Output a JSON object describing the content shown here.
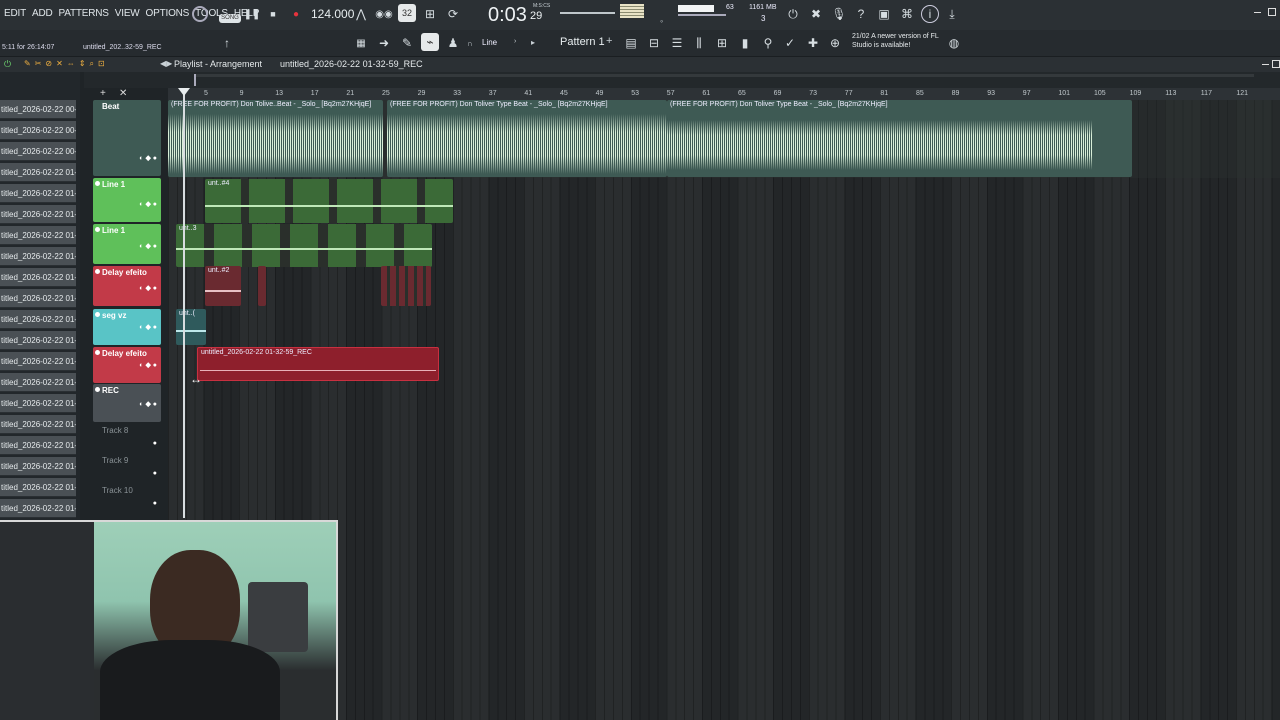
{
  "menu": [
    "EDIT",
    "ADD",
    "PATTERNS",
    "VIEW",
    "OPTIONS",
    "TOOLS",
    "HELP"
  ],
  "transport": {
    "mode": "SONG",
    "tempo": "124.000",
    "time": "0:03",
    "time_small": "29",
    "time_unit": "M:S:CS",
    "cpu": "63",
    "mem": "1161 MB",
    "voices": "3"
  },
  "hint": {
    "date": "21/02",
    "text": "A newer version of FL Studio is available!"
  },
  "toolbar2": {
    "line_label": "Line",
    "pattern": "Pattern 1"
  },
  "status": {
    "left": "5:11 for 26:14:07",
    "file": "untitled_202..32-59_REC"
  },
  "playlist": {
    "title": "Playlist - Arrangement",
    "file": "untitled_2026-02-22 01-32-59_REC"
  },
  "browser_items": [
    "titled_2026-02-22 00-...",
    "titled_2026-02-22 00-...",
    "titled_2026-02-22 00-...",
    "titled_2026-02-22 01-...",
    "titled_2026-02-22 01-...",
    "titled_2026-02-22 01-...",
    "titled_2026-02-22 01-...",
    "titled_2026-02-22 01-...",
    "titled_2026-02-22 01-...",
    "titled_2026-02-22 01-...",
    "titled_2026-02-22 01-...",
    "titled_2026-02-22 01-...",
    "titled_2026-02-22 01-...",
    "titled_2026-02-22 01-...",
    "titled_2026-02-22 01-...",
    "titled_2026-02-22 01-...",
    "titled_2026-02-22 01-...",
    "titled_2026-02-22 01-...",
    "titled_2026-02-22 01-...",
    "titled_2026-02-22 01-..."
  ],
  "ruler": [
    "5",
    "9",
    "13",
    "17",
    "21",
    "25",
    "29",
    "33",
    "37",
    "41",
    "45",
    "49",
    "53",
    "57",
    "61",
    "65",
    "69",
    "73",
    "77",
    "81",
    "85",
    "89",
    "93",
    "97",
    "101",
    "105",
    "109",
    "113",
    "117",
    "121"
  ],
  "tracks": [
    {
      "name": "Beat",
      "color": "#3e5a54"
    },
    {
      "name": "Line 1",
      "color": "#5fc05a"
    },
    {
      "name": "Line 1",
      "color": "#5fc05a"
    },
    {
      "name": "Delay efeito",
      "color": "#c23a48"
    },
    {
      "name": "seg vz",
      "color": "#59c4c6"
    },
    {
      "name": "Delay efeito",
      "color": "#c23a48"
    },
    {
      "name": "REC",
      "color": "#4a5055"
    },
    {
      "name": "Track 8",
      "color": ""
    },
    {
      "name": "Track 9",
      "color": ""
    },
    {
      "name": "Track 10",
      "color": ""
    }
  ],
  "beat_clips": [
    "(FREE FOR PROFIT) Don Tolive..Beat - _Solo_ [Bq2m27KHjqE]",
    "(FREE FOR PROFIT) Don Toliver Type Beat - _Solo_ [Bq2m27KHjqE]",
    "(FREE FOR PROFIT) Don Toliver Type Beat - _Solo_ [Bq2m27KHjqE]"
  ],
  "clip_labels": {
    "line1": "unt..#4",
    "line2": "unt..3",
    "delay": "unt..#2",
    "seg": "unt..(",
    "rec": "untitled_2026-02-22 01-32-59_REC"
  }
}
